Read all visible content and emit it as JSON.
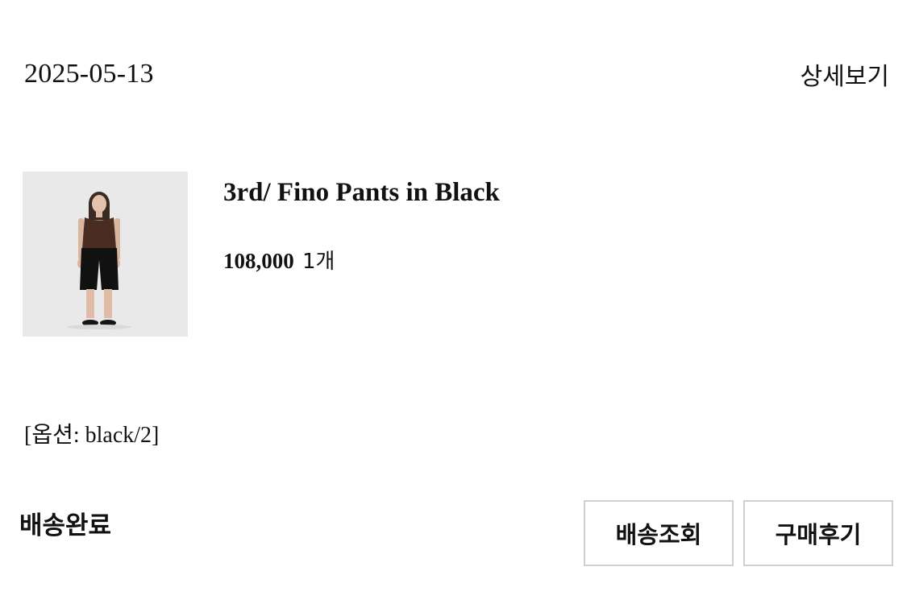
{
  "order": {
    "date": "2025-05-13",
    "detail_label": "상세보기",
    "status": "배송완료"
  },
  "product": {
    "name": "3rd/ Fino Pants in Black",
    "price": "108,000",
    "quantity": "1개",
    "option": "[옵션: black/2]"
  },
  "actions": {
    "track_label": "배송조회",
    "review_label": "구매후기"
  },
  "colors": {
    "background": "#ffffff",
    "text": "#111111",
    "button_border": "#cfcfcf",
    "thumbnail_bg": "#e9e9ea"
  }
}
